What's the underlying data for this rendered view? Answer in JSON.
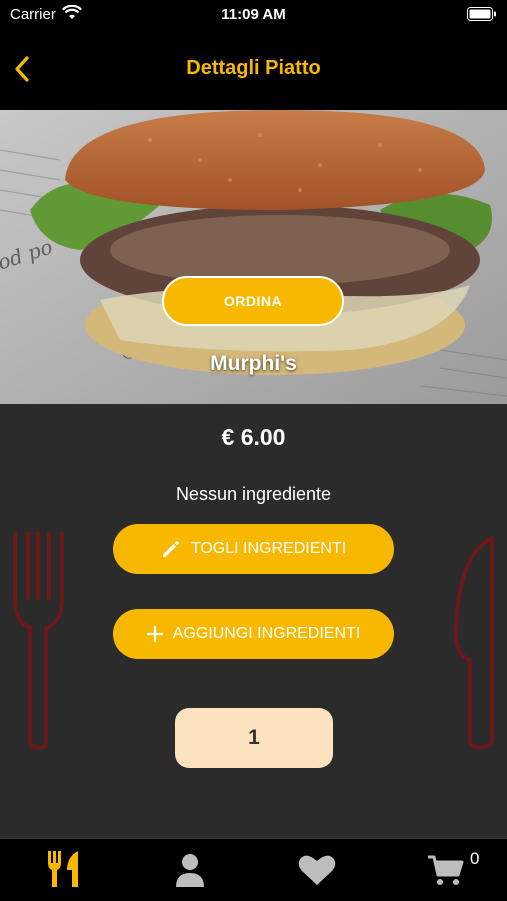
{
  "status_bar": {
    "carrier": "Carrier",
    "time": "11:09 AM"
  },
  "header": {
    "title": "Dettagli Piatto",
    "back_icon": "chevron-left-icon"
  },
  "dish": {
    "order_label": "ORDINA",
    "name": "Murphi's",
    "price": "€ 6.00",
    "ingredients_text": "Nessun ingrediente",
    "remove_ingredients_label": "TOGLI INGREDIENTI",
    "add_ingredients_label": "AGGIUNGI INGREDIENTI",
    "quantity": "1"
  },
  "tab_bar": {
    "items": [
      {
        "icon": "fork-knife-icon",
        "active": true
      },
      {
        "icon": "user-icon",
        "active": false
      },
      {
        "icon": "heart-icon",
        "active": false
      },
      {
        "icon": "cart-icon",
        "active": false
      }
    ],
    "cart_count": "0"
  },
  "colors": {
    "accent": "#f9b800",
    "background": "#2b2b2b",
    "bar": "#000000",
    "quantity_bg": "#fde3bd",
    "decor": "#6b1a1a"
  }
}
